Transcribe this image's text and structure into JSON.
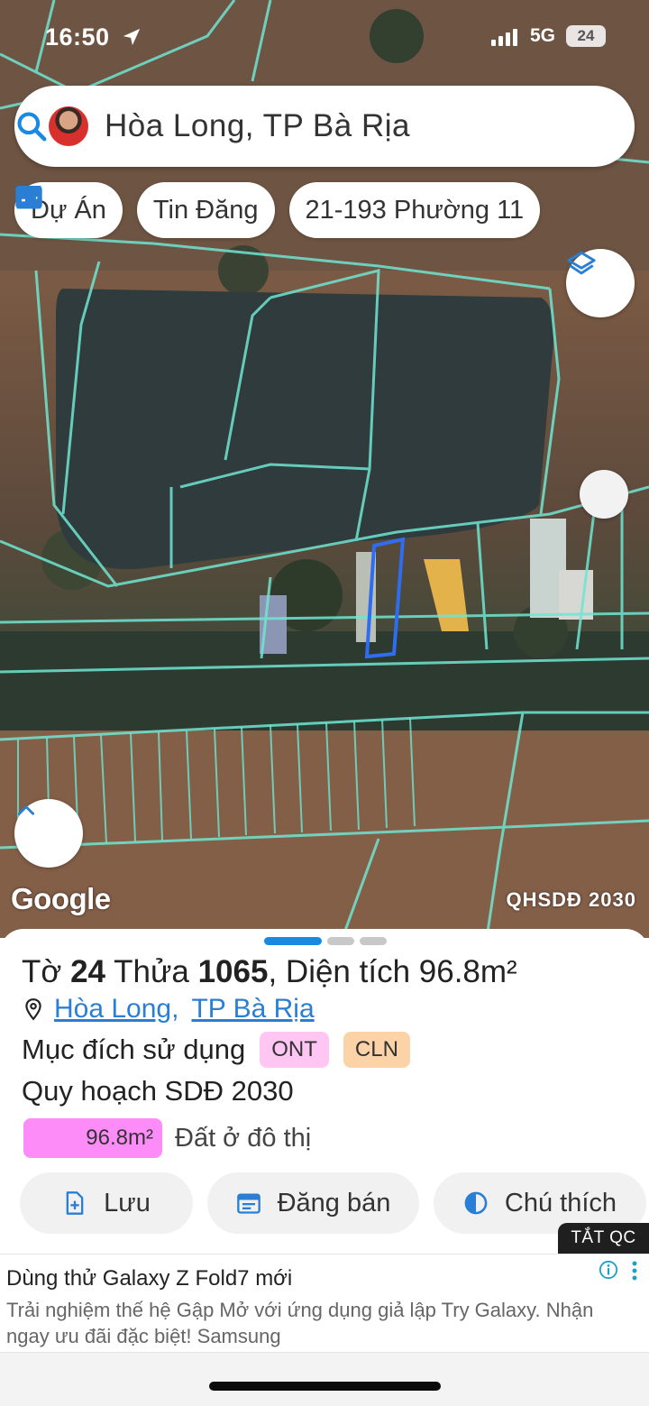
{
  "status_bar": {
    "time": "16:50",
    "network": "5G",
    "battery": "24"
  },
  "search": {
    "title": "Hòa Long, TP Bà Rịa"
  },
  "chips": [
    {
      "label": "Dự Án",
      "icon": "building-icon"
    },
    {
      "label": "Tin Đăng",
      "icon": "calendar-icon"
    },
    {
      "label": "21-193 Phường 11"
    }
  ],
  "map": {
    "attribution": "Google",
    "layer_label": "QHSDĐ 2030"
  },
  "parcel": {
    "to_label": "Tờ",
    "to_number": "24",
    "thua_label": "Thửa",
    "thua_number": "1065",
    "area_label": ", Diện tích",
    "area_value": "96.8m²",
    "location": [
      "Hòa Long",
      "TP Bà Rịa"
    ],
    "location_sep": ",",
    "purpose_label": "Mục đích sử dụng",
    "purpose_tags": [
      {
        "code": "ONT",
        "color": "#ffc6f4"
      },
      {
        "code": "CLN",
        "color": "#fcd3a6"
      }
    ],
    "plan_label": "Quy hoạch SDĐ 2030",
    "plan_area": "96.8m²",
    "plan_fill_fraction": 1.0,
    "plan_color": "#fe8cf8",
    "plan_type": "Đất ở đô thị"
  },
  "actions": [
    {
      "label": "Lưu",
      "icon": "save-icon"
    },
    {
      "label": "Đăng bán",
      "icon": "calendar-icon"
    },
    {
      "label": "Chú thích",
      "icon": "legend-icon"
    }
  ],
  "ad": {
    "close_label": "TẮT QC",
    "title": "Dùng thử Galaxy Z Fold7 mới",
    "body": "Trải nghiệm thế hệ Gập Mở với ứng dụng giả lập Try Galaxy. Nhận ngay ưu đãi đặc biệt! Samsung"
  },
  "colors": {
    "accent": "#1a8ae0",
    "link": "#2a7fd4",
    "parcel_lines": "#6fe6d2",
    "selected_parcel": "#2f6df0"
  }
}
